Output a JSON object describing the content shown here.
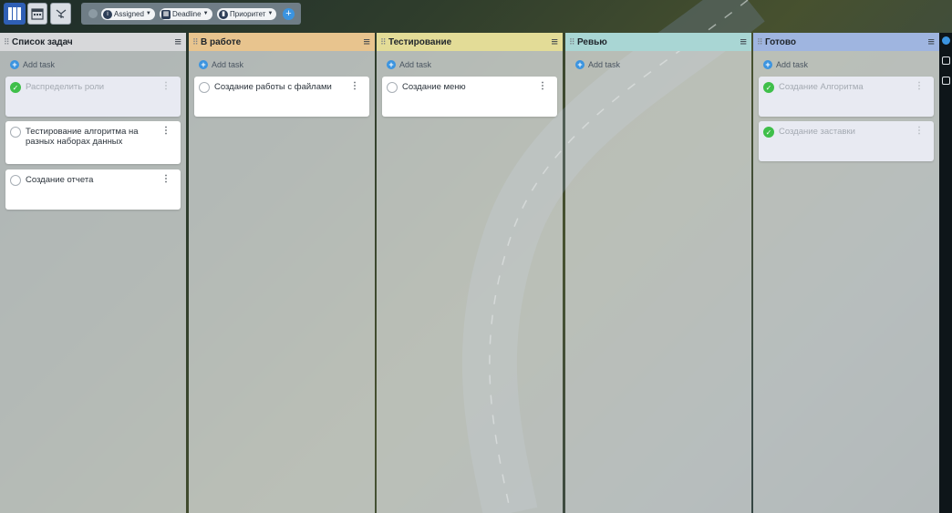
{
  "toolbar": {
    "icons": [
      "board-view-icon",
      "calendar-view-icon",
      "flow-view-icon"
    ],
    "filters": [
      {
        "label": "Assigned",
        "icon": "info-icon"
      },
      {
        "label": "Deadline",
        "icon": "calendar-icon"
      },
      {
        "label": "Приоритет",
        "icon": "priority-bars-icon"
      }
    ],
    "add_symbol": "+"
  },
  "columns": [
    {
      "title": "Список задач",
      "color": "#d7d8da",
      "add_label": "Add task",
      "cards": [
        {
          "text": "Распределить роли",
          "done": true
        },
        {
          "text": "Тестирование алгоритма на разных наборах данных",
          "done": false
        },
        {
          "text": "Создание отчета",
          "done": false
        }
      ]
    },
    {
      "title": "В работе",
      "color": "#e8c48e",
      "add_label": "Add task",
      "cards": [
        {
          "text": "Создание работы с файлами",
          "done": false
        }
      ]
    },
    {
      "title": "Тестирование",
      "color": "#e3dc97",
      "add_label": "Add task",
      "cards": [
        {
          "text": "Создание меню",
          "done": false
        }
      ]
    },
    {
      "title": "Ревью",
      "color": "#a9d6d4",
      "add_label": "Add task",
      "cards": []
    },
    {
      "title": "Готово",
      "color": "#9fb5e0",
      "add_label": "Add task",
      "cards": [
        {
          "text": "Создание Алгоритма",
          "done": true
        },
        {
          "text": "Создание заставки",
          "done": true
        }
      ]
    }
  ],
  "symbols": {
    "kebab": "⋮",
    "menu": "≡",
    "grip": "⠿",
    "plus": "+",
    "check": "✓"
  }
}
